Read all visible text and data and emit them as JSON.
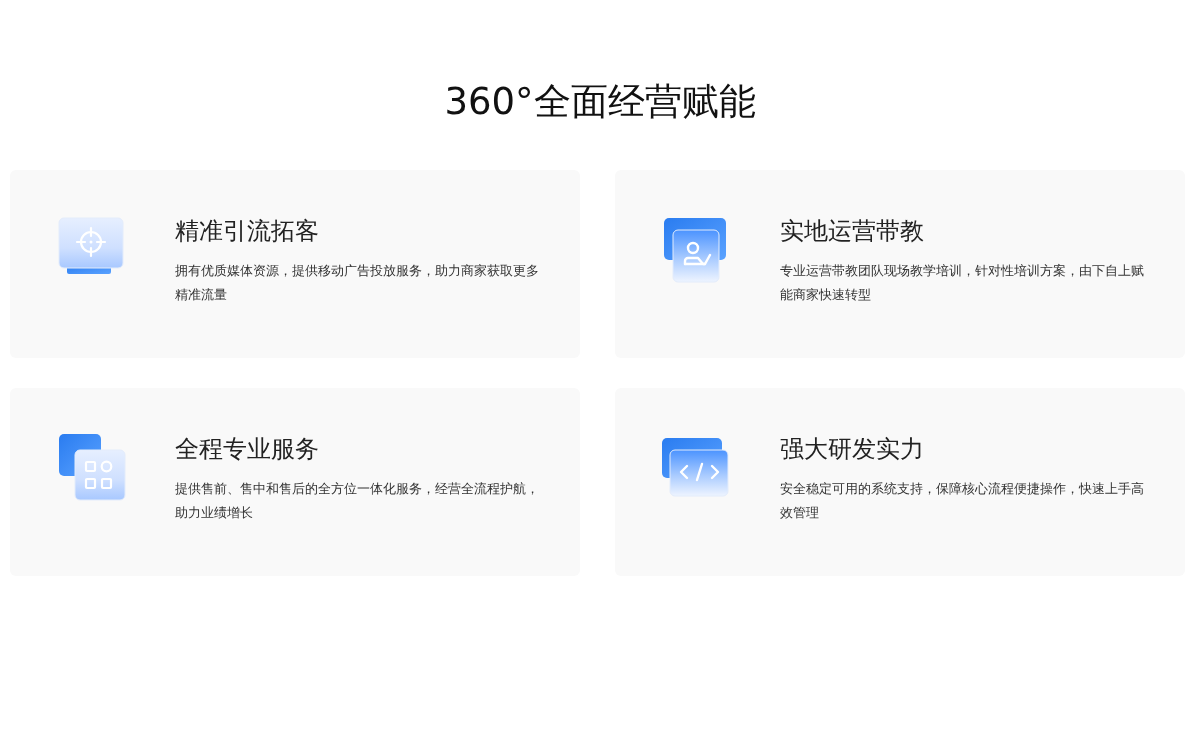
{
  "heading": "360°全面经营赋能",
  "cards": [
    {
      "kind": "target",
      "title": "精准引流拓客",
      "description": "拥有优质媒体资源，提供移动广告投放服务，助力商家获取更多精准流量"
    },
    {
      "kind": "person",
      "title": "实地运营带教",
      "description": "专业运营带教团队现场教学培训，针对性培训方案，由下自上赋能商家快速转型"
    },
    {
      "kind": "grid",
      "title": "全程专业服务",
      "description": "提供售前、售中和售后的全方位一体化服务，经营全流程护航，助力业绩增长"
    },
    {
      "kind": "code",
      "title": "强大研发实力",
      "description": "安全稳定可用的系统支持，保障核心流程便捷操作，快速上手高效管理"
    }
  ]
}
